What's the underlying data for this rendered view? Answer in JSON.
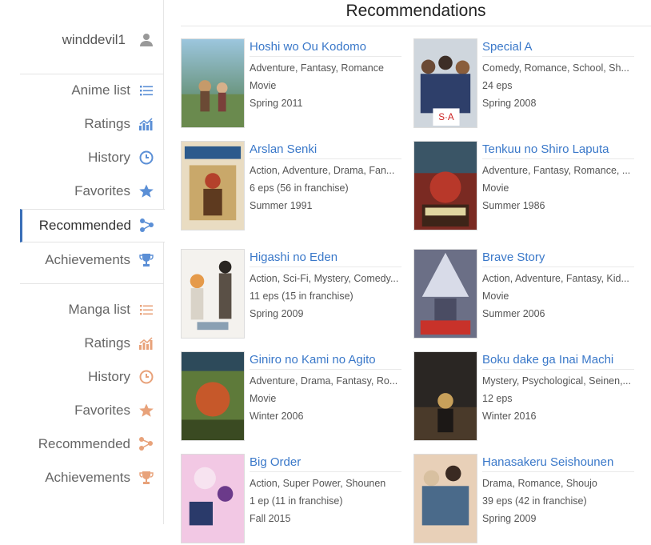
{
  "user": {
    "name": "winddevil1",
    "icon": "user-icon"
  },
  "colors": {
    "anime_accent": "#5b8fd6",
    "manga_accent": "#e8a27a",
    "link": "#3a78c9",
    "active_border": "#3a6fb8"
  },
  "anime_nav": [
    {
      "label": "Anime list",
      "icon": "list-icon"
    },
    {
      "label": "Ratings",
      "icon": "chart-icon"
    },
    {
      "label": "History",
      "icon": "history-icon"
    },
    {
      "label": "Favorites",
      "icon": "star-icon"
    },
    {
      "label": "Recommended",
      "icon": "recommend-icon",
      "active": true
    },
    {
      "label": "Achievements",
      "icon": "trophy-icon"
    }
  ],
  "manga_nav": [
    {
      "label": "Manga list",
      "icon": "list-icon"
    },
    {
      "label": "Ratings",
      "icon": "chart-icon"
    },
    {
      "label": "History",
      "icon": "history-icon"
    },
    {
      "label": "Favorites",
      "icon": "star-icon"
    },
    {
      "label": "Recommended",
      "icon": "recommend-icon"
    },
    {
      "label": "Achievements",
      "icon": "trophy-icon"
    }
  ],
  "page": {
    "title": "Recommendations"
  },
  "recommendations": [
    {
      "title": "Hoshi wo Ou Kodomo",
      "genres": "Adventure, Fantasy, Romance",
      "episodes": "Movie",
      "season": "Spring 2011"
    },
    {
      "title": "Special A",
      "genres": "Comedy, Romance, School, Sh...",
      "episodes": "24 eps",
      "season": "Spring 2008"
    },
    {
      "title": "Arslan Senki",
      "genres": "Action, Adventure, Drama, Fan...",
      "episodes": "6 eps (56 in franchise)",
      "season": "Summer 1991"
    },
    {
      "title": "Tenkuu no Shiro Laputa",
      "genres": "Adventure, Fantasy, Romance, ...",
      "episodes": "Movie",
      "season": "Summer 1986"
    },
    {
      "title": "Higashi no Eden",
      "genres": "Action, Sci-Fi, Mystery, Comedy...",
      "episodes": "11 eps (15 in franchise)",
      "season": "Spring 2009"
    },
    {
      "title": "Brave Story",
      "genres": "Action, Adventure, Fantasy, Kid...",
      "episodes": "Movie",
      "season": "Summer 2006"
    },
    {
      "title": "Giniro no Kami no Agito",
      "genres": "Adventure, Drama, Fantasy, Ro...",
      "episodes": "Movie",
      "season": "Winter 2006"
    },
    {
      "title": "Boku dake ga Inai Machi",
      "genres": "Mystery, Psychological, Seinen,...",
      "episodes": "12 eps",
      "season": "Winter 2016"
    },
    {
      "title": "Big Order",
      "genres": "Action, Super Power, Shounen",
      "episodes": "1 ep (11 in franchise)",
      "season": "Fall 2015"
    },
    {
      "title": "Hanasakeru Seishounen",
      "genres": "Drama, Romance, Shoujo",
      "episodes": "39 eps (42 in franchise)",
      "season": "Spring 2009"
    }
  ]
}
